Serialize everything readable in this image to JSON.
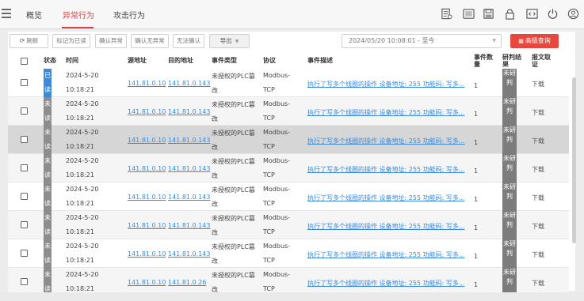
{
  "nav": {
    "tabs": [
      {
        "label": "概览"
      },
      {
        "label": "异常行为",
        "active": true
      },
      {
        "label": "攻击行为"
      }
    ],
    "right_icons": [
      "report-icon",
      "screen-icon",
      "save-icon",
      "lock-icon",
      "code-icon",
      "power-icon",
      "user-icon"
    ]
  },
  "toolbar": {
    "refresh": "刷新",
    "mark_read": "标记为已读",
    "confirm_abnormal": "确认异常",
    "confirm_normal": "确认无异常",
    "cannot_confirm": "无法确认",
    "export": "导出",
    "date_range": "2024/05/20 10:08:01 - 至今",
    "advanced_query": "高级查询"
  },
  "colors": {
    "accent": "#e04040",
    "link": "#3b8ad9",
    "read_badge": "#3b8ad9",
    "unread_badge": "#8d8d8d"
  },
  "table": {
    "headers": {
      "status": "状态",
      "time": "时间",
      "src": "源地址",
      "dst": "目的地址",
      "event_type": "事件类型",
      "protocol": "协议",
      "desc": "事件描述",
      "count": "事件数量",
      "judge": "研判结果",
      "report": "报文取证"
    },
    "rows": [
      {
        "status": "已读",
        "date": "2024-5-20",
        "clock": "10:18:21",
        "src": "141.81.0.10",
        "dst": "141.81.0.143",
        "etype_a": "未授权的PLC篡",
        "etype_b": "改",
        "proto_a": "Modbus-",
        "proto_b": "TCP",
        "desc": "执行了写多个线圈的操作 设备地址: 255 功能码: 写多...",
        "count": "1",
        "judge": "未研判",
        "dl": "下载"
      },
      {
        "status": "未读",
        "date": "2024-5-20",
        "clock": "10:18:21",
        "src": "141.81.0.10",
        "dst": "141.81.0.143",
        "etype_a": "未授权的PLC篡",
        "etype_b": "改",
        "proto_a": "Modbus-",
        "proto_b": "TCP",
        "desc": "执行了写多个线圈的操作 设备地址: 255 功能码: 写多...",
        "count": "1",
        "judge": "未研判",
        "dl": "下载"
      },
      {
        "status": "未读",
        "date": "2024-5-20",
        "clock": "10:18:21",
        "src": "141.81.0.10",
        "dst": "141.81.0.143",
        "etype_a": "未授权的PLC篡",
        "etype_b": "改",
        "proto_a": "Modbus-",
        "proto_b": "TCP",
        "desc": "执行了写多个线圈的操作 设备地址: 255 功能码: 写多...",
        "count": "1",
        "judge": "未研判",
        "dl": "下载"
      },
      {
        "status": "未读",
        "date": "2024-5-20",
        "clock": "10:18:21",
        "src": "141.81.0.10",
        "dst": "141.81.0.143",
        "etype_a": "未授权的PLC篡",
        "etype_b": "改",
        "proto_a": "Modbus-",
        "proto_b": "TCP",
        "desc": "执行了写多个线圈的操作 设备地址: 255 功能码: 写多...",
        "count": "1",
        "judge": "未研判",
        "dl": "下载"
      },
      {
        "status": "未读",
        "date": "2024-5-20",
        "clock": "10:18:21",
        "src": "141.81.0.10",
        "dst": "141.81.0.143",
        "etype_a": "未授权的PLC篡",
        "etype_b": "改",
        "proto_a": "Modbus-",
        "proto_b": "TCP",
        "desc": "执行了写多个线圈的操作 设备地址: 255 功能码: 写多...",
        "count": "1",
        "judge": "未研判",
        "dl": "下载"
      },
      {
        "status": "未读",
        "date": "2024-5-20",
        "clock": "10:18:21",
        "src": "141.81.0.10",
        "dst": "141.81.0.143",
        "etype_a": "未授权的PLC篡",
        "etype_b": "改",
        "proto_a": "Modbus-",
        "proto_b": "TCP",
        "desc": "执行了写多个线圈的操作 设备地址: 255 功能码: 写多...",
        "count": "1",
        "judge": "未研判",
        "dl": "下载"
      },
      {
        "status": "未读",
        "date": "2024-5-20",
        "clock": "10:18:21",
        "src": "141.81.0.10",
        "dst": "141.81.0.143",
        "etype_a": "未授权的PLC篡",
        "etype_b": "改",
        "proto_a": "Modbus-",
        "proto_b": "TCP",
        "desc": "执行了写多个线圈的操作 设备地址: 255 功能码: 写多...",
        "count": "1",
        "judge": "未研判",
        "dl": "下载"
      },
      {
        "status": "未读",
        "date": "2024-5-20",
        "clock": "10:18:21",
        "src": "141.81.0.10",
        "dst": "141.81.0.26",
        "etype_a": "未授权的PLC篡",
        "etype_b": "改",
        "proto_a": "Modbus-",
        "proto_b": "TCP",
        "desc": "执行了写多个线圈的操作 设备地址: 255 功能码: 写多...",
        "count": "1",
        "judge": "未研判",
        "dl": "下载"
      }
    ]
  }
}
